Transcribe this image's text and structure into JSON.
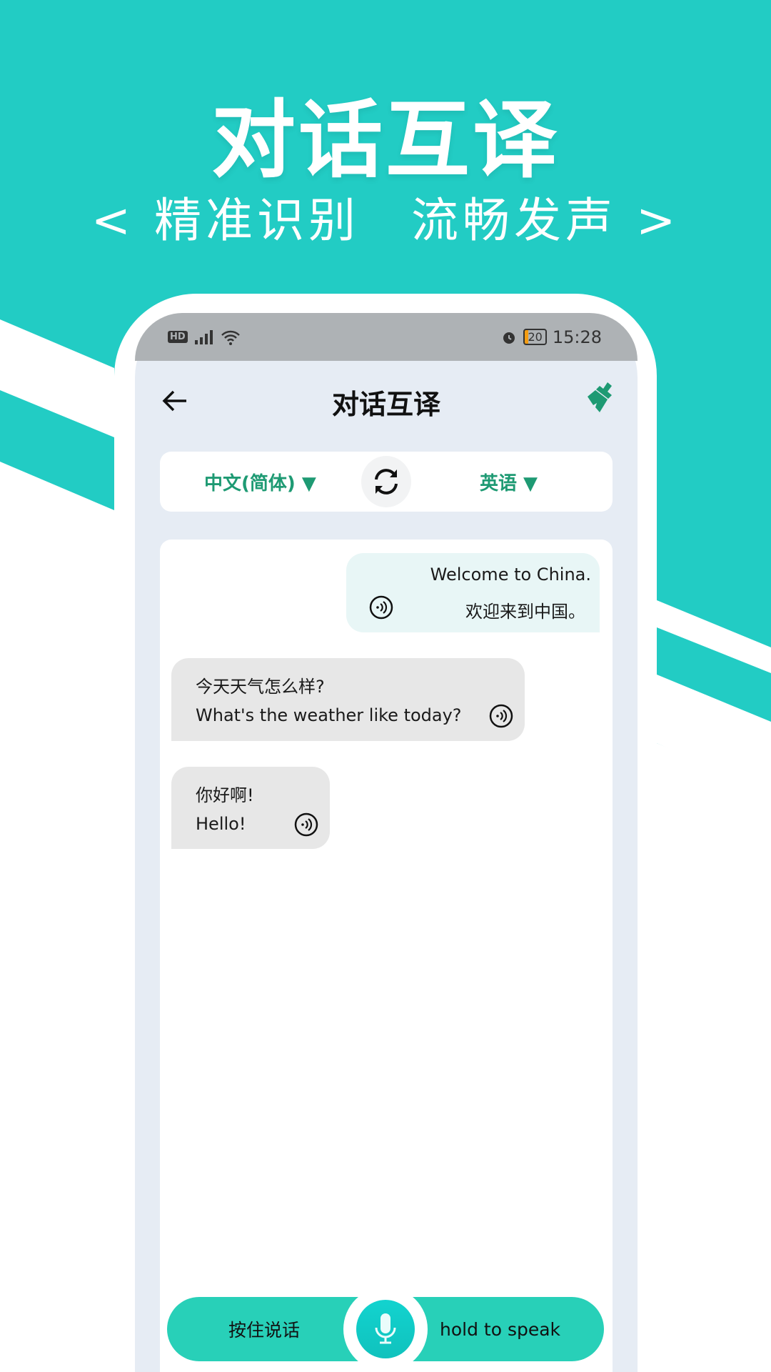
{
  "promo": {
    "headline": "对话互译",
    "subtitle": "< 精准识别　流畅发声 >"
  },
  "colors": {
    "background": "#22ccc4",
    "accent_green": "#1e9a73",
    "button": "#28d0b8",
    "status_bar": "#aeb2b5"
  },
  "status_bar": {
    "left_icons": [
      "hd-icon",
      "signal-icon",
      "wifi-icon"
    ],
    "hd": "HD",
    "battery": "20",
    "time": "15:28"
  },
  "header": {
    "back_icon": "arrow-left-icon",
    "title": "对话互译",
    "clear_icon": "broom-icon"
  },
  "languages": {
    "source": "中文(简体) ▼",
    "target": "英语 ▼",
    "swap_icon": "swap-icon"
  },
  "messages": [
    {
      "side": "right",
      "primary": "Welcome to China.",
      "secondary": "欢迎来到中国。"
    },
    {
      "side": "left",
      "primary": "今天天气怎么样?",
      "secondary": "What's the weather like today?"
    },
    {
      "side": "left",
      "primary": "你好啊!",
      "secondary": "Hello!"
    }
  ],
  "bottom": {
    "left_label": "按住说话",
    "right_label": "hold to speak",
    "mic_icon": "microphone-icon"
  }
}
